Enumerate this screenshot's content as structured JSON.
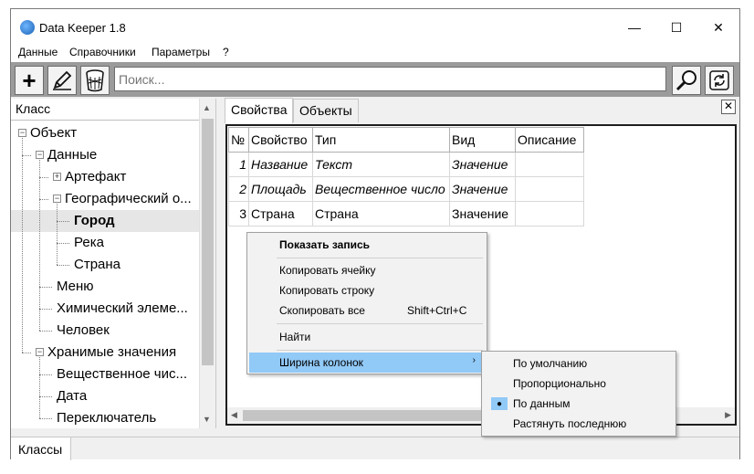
{
  "app": {
    "title": "Data Keeper 1.8",
    "window_controls": {
      "minimize": "—",
      "maximize": "☐",
      "close": "✕"
    }
  },
  "menu": [
    "Данные",
    "Справочники",
    "Параметры",
    "?"
  ],
  "toolbar": {
    "add_glyph": "+",
    "search_placeholder": "Поиск..."
  },
  "left_panel": {
    "header": "Класс",
    "tree": [
      {
        "label": "Объект",
        "level": 0,
        "expander": "−"
      },
      {
        "label": "Данные",
        "level": 1,
        "expander": "−"
      },
      {
        "label": "Артефакт",
        "level": 2,
        "expander": "+"
      },
      {
        "label": "Географический о...",
        "level": 2,
        "expander": "−"
      },
      {
        "label": "Город",
        "level": 3,
        "selected": true
      },
      {
        "label": "Река",
        "level": 3
      },
      {
        "label": "Страна",
        "level": 3
      },
      {
        "label": "Меню",
        "level": 2
      },
      {
        "label": "Химический элеме...",
        "level": 2
      },
      {
        "label": "Человек",
        "level": 2
      },
      {
        "label": "Хранимые значения",
        "level": 1,
        "expander": "−"
      },
      {
        "label": "Вещественное чис...",
        "level": 2
      },
      {
        "label": "Дата",
        "level": 2
      },
      {
        "label": "Переключатель",
        "level": 2
      }
    ]
  },
  "bottom_tab": "Классы",
  "tabs": [
    "Свойства",
    "Объекты"
  ],
  "grid": {
    "columns": [
      "№",
      "Свойство",
      "Тип",
      "Вид",
      "Описание"
    ],
    "rows": [
      {
        "num": "1",
        "property": "Название",
        "type": "Текст",
        "kind": "Значение",
        "description": "",
        "italic": true
      },
      {
        "num": "2",
        "property": "Площадь",
        "type": "Вещественное число",
        "kind": "Значение",
        "description": "",
        "italic": true
      },
      {
        "num": "3",
        "property": "Страна",
        "type": "Страна",
        "kind": "Значение",
        "description": "",
        "italic": false
      }
    ]
  },
  "context_menu": {
    "show_record": "Показать запись",
    "copy_cell": "Копировать ячейку",
    "copy_row": "Копировать строку",
    "copy_all": "Скопировать все",
    "copy_all_shortcut": "Shift+Ctrl+C",
    "find": "Найти",
    "column_width": "Ширина колонок",
    "submenu": {
      "default": "По умолчанию",
      "proportional": "Пропорционально",
      "by_data": "По данным",
      "stretch_last": "Растянуть последнюю",
      "checked_mark": "●"
    }
  },
  "colors": {
    "highlight": "#91c9f7",
    "toolbar": "#9b9b9b"
  }
}
